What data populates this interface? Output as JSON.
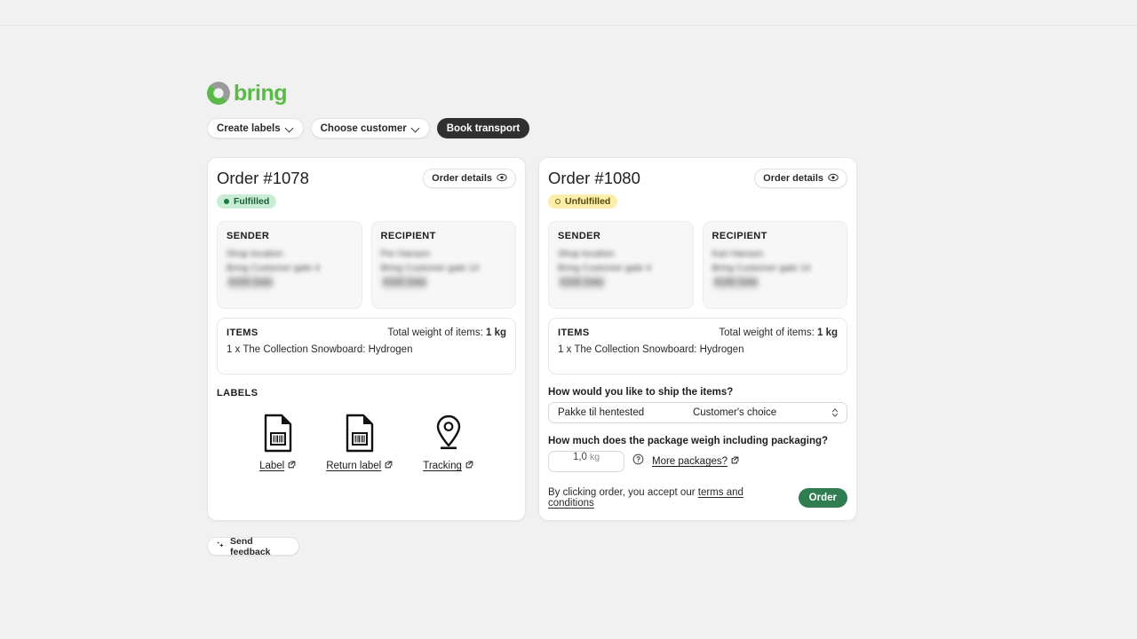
{
  "brand": {
    "name": "bring",
    "logo_icon": "bring-circle-logo",
    "green": "#5aba47",
    "gray": "#9a9a9a"
  },
  "nav": {
    "items": [
      {
        "label": "Create labels",
        "icon": "chevron-down-icon",
        "active": false
      },
      {
        "label": "Choose customer",
        "icon": "chevron-down-icon",
        "active": false
      },
      {
        "label": "Book transport",
        "icon": "",
        "active": true
      }
    ]
  },
  "orders": [
    {
      "title": "Order #1078",
      "details_label": "Order details",
      "details_icon": "eye-icon",
      "status": {
        "label": "Fulfilled",
        "type": "fulfilled",
        "icon": "filled-dot-icon",
        "bg": "#c8ecd4",
        "fg": "#1b5e34"
      },
      "sender": {
        "heading": "SENDER",
        "lines": [
          "Shop location",
          "Bring Customer gate 4",
          "0155 Oslo"
        ]
      },
      "recipient": {
        "heading": "RECIPIENT",
        "lines": [
          "Per Hansen",
          "Bring Customer gate 14",
          "0155 Oslo"
        ]
      },
      "items": {
        "heading": "ITEMS",
        "total_weight_prefix": "Total weight of items:",
        "total_weight_value": "1 kg",
        "lines": [
          "1 x The Collection Snowboard: Hydrogen"
        ]
      },
      "labels": {
        "heading": "LABELS",
        "items": [
          {
            "label": "Label",
            "icon": "document-barcode-icon",
            "external_icon": "external-link-icon"
          },
          {
            "label": "Return label",
            "icon": "document-barcode-icon",
            "external_icon": "external-link-icon"
          },
          {
            "label": "Tracking",
            "icon": "map-pin-icon",
            "external_icon": "external-link-icon"
          }
        ]
      }
    },
    {
      "title": "Order #1080",
      "details_label": "Order details",
      "details_icon": "eye-icon",
      "status": {
        "label": "Unfulfilled",
        "type": "unfulfilled",
        "icon": "ring-dot-icon",
        "bg": "#fbeeab",
        "fg": "#5a4710"
      },
      "sender": {
        "heading": "SENDER",
        "lines": [
          "Shop location",
          "Bring Customer gate 4",
          "0155 Oslo"
        ]
      },
      "recipient": {
        "heading": "RECIPIENT",
        "lines": [
          "Kari Hansen",
          "Bring Customer gate 14",
          "0155 Oslo"
        ]
      },
      "items": {
        "heading": "ITEMS",
        "total_weight_prefix": "Total weight of items:",
        "total_weight_value": "1 kg",
        "lines": [
          "1 x The Collection Snowboard: Hydrogen"
        ]
      },
      "form": {
        "ship_question": "How would you like to ship the items?",
        "ship_service": "Pakke til hentested",
        "ship_option": "Customer's choice",
        "ship_select_icon": "up-down-chevron-icon",
        "weight_question": "How much does the package weigh including packaging?",
        "weight_value": "1,0",
        "weight_unit": "kg",
        "help_icon": "question-circle-icon",
        "more_packages_label": "More packages?",
        "more_packages_icon": "external-link-icon",
        "terms_prefix": "By clicking order, you accept our",
        "terms_link": "terms and conditions",
        "order_button": "Order",
        "order_button_color": "#2f7d51"
      }
    }
  ],
  "feedback": {
    "label": "Send feedback",
    "icon": "sparkle-icon"
  }
}
